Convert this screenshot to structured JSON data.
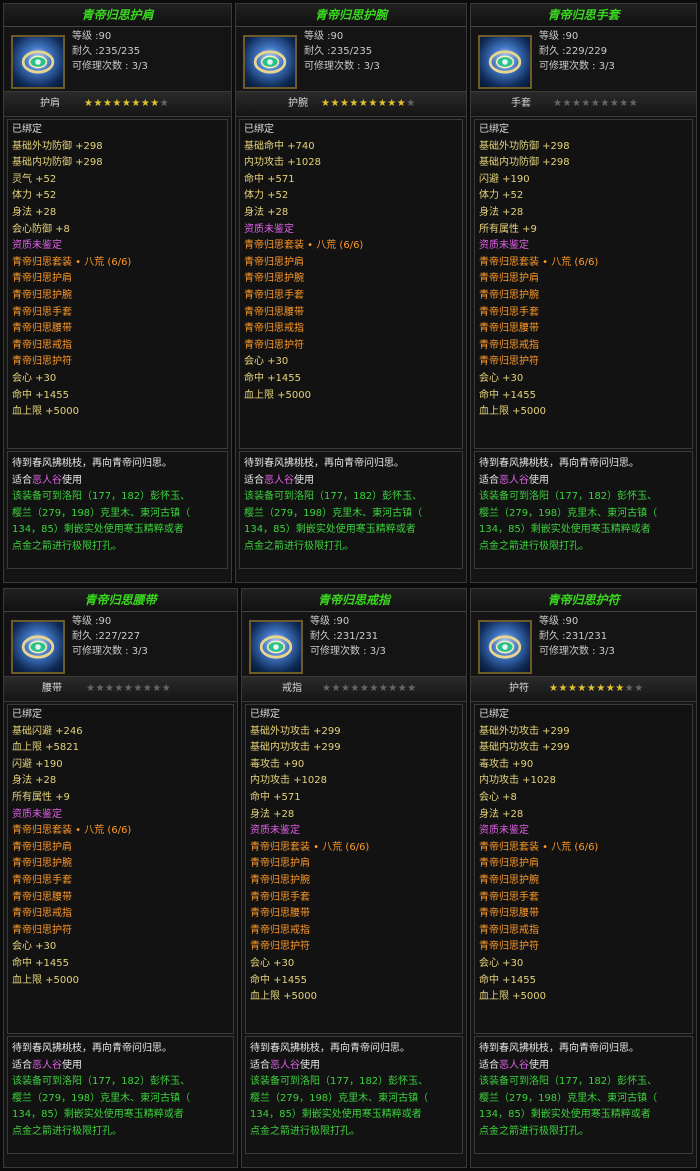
{
  "cards": [
    {
      "title": "青帝归思护肩",
      "icon": "shoulder-guard-icon",
      "level": "等级 :90",
      "durability": "耐久 :235/235",
      "repair": "可修理次数 : 3/3",
      "type": "护肩",
      "stars": 8,
      "stars_total": 9,
      "bound": "已绑定",
      "attrs": [
        "基础外功防御 +298",
        "基础内功防御 +298",
        "灵气 +52",
        "体力 +52",
        "身法 +28",
        "会心防御 +8"
      ],
      "quality": "资质未鉴定",
      "set_name": "青帝归思套装 • 八荒 (6/6)",
      "set_items": [
        "青帝归思护肩",
        "青帝归思护腕",
        "青帝归思手套",
        "青帝归思腰带",
        "青帝归思戒指",
        "青帝归思护符"
      ],
      "set_bonus": [
        "会心 +30",
        "命中 +1455",
        "血上限 +5000"
      ]
    },
    {
      "title": "青帝归思护腕",
      "icon": "bracer-icon",
      "level": "等级 :90",
      "durability": "耐久 :235/235",
      "repair": "可修理次数 : 3/3",
      "type": "护腕",
      "stars": 9,
      "stars_total": 10,
      "bound": "已绑定",
      "attrs": [
        "基础命中 +740",
        "内功攻击 +1028",
        "命中 +571",
        "体力 +52",
        "身法 +28"
      ],
      "quality": "资质未鉴定",
      "set_name": "青帝归思套装 • 八荒 (6/6)",
      "set_items": [
        "青帝归思护肩",
        "青帝归思护腕",
        "青帝归思手套",
        "青帝归思腰带",
        "青帝归思戒指",
        "青帝归思护符"
      ],
      "set_bonus": [
        "会心 +30",
        "命中 +1455",
        "血上限 +5000"
      ]
    },
    {
      "title": "青帝归思手套",
      "icon": "gloves-icon",
      "level": "等级 :90",
      "durability": "耐久 :229/229",
      "repair": "可修理次数 : 3/3",
      "type": "手套",
      "stars": 0,
      "stars_total": 9,
      "bound": "已绑定",
      "attrs": [
        "基础外功防御 +298",
        "基础内功防御 +298",
        "闪避 +190",
        "体力 +52",
        "身法 +28",
        "所有属性 +9"
      ],
      "quality": "资质未鉴定",
      "set_name": "青帝归思套装 • 八荒 (6/6)",
      "set_items": [
        "青帝归思护肩",
        "青帝归思护腕",
        "青帝归思手套",
        "青帝归思腰带",
        "青帝归思戒指",
        "青帝归思护符"
      ],
      "set_bonus": [
        "会心 +30",
        "命中 +1455",
        "血上限 +5000"
      ]
    },
    {
      "title": "青帝归思腰带",
      "icon": "belt-icon",
      "level": "等级 :90",
      "durability": "耐久 :227/227",
      "repair": "可修理次数 : 3/3",
      "type": "腰带",
      "stars": 0,
      "stars_total": 9,
      "bound": "已绑定",
      "attrs": [
        "基础闪避 +246",
        "血上限 +5821",
        "闪避 +190",
        "身法 +28",
        "所有属性 +9"
      ],
      "quality": "资质未鉴定",
      "set_name": "青帝归思套装 • 八荒 (6/6)",
      "set_items": [
        "青帝归思护肩",
        "青帝归思护腕",
        "青帝归思手套",
        "青帝归思腰带",
        "青帝归思戒指",
        "青帝归思护符"
      ],
      "set_bonus": [
        "会心 +30",
        "命中 +1455",
        "血上限 +5000"
      ]
    },
    {
      "title": "青帝归思戒指",
      "icon": "ring-icon",
      "level": "等级 :90",
      "durability": "耐久 :231/231",
      "repair": "可修理次数 : 3/3",
      "type": "戒指",
      "stars": 0,
      "stars_total": 10,
      "bound": "已绑定",
      "attrs": [
        "基础外功攻击 +299",
        "基础内功攻击 +299",
        "毒攻击 +90",
        "内功攻击 +1028",
        "命中 +571",
        "身法 +28"
      ],
      "quality": "资质未鉴定",
      "set_name": "青帝归思套装 • 八荒 (6/6)",
      "set_items": [
        "青帝归思护肩",
        "青帝归思护腕",
        "青帝归思手套",
        "青帝归思腰带",
        "青帝归思戒指",
        "青帝归思护符"
      ],
      "set_bonus": [
        "会心 +30",
        "命中 +1455",
        "血上限 +5000"
      ]
    },
    {
      "title": "青帝归思护符",
      "icon": "amulet-icon",
      "level": "等级 :90",
      "durability": "耐久 :231/231",
      "repair": "可修理次数 : 3/3",
      "type": "护符",
      "stars": 8,
      "stars_total": 10,
      "bound": "已绑定",
      "attrs": [
        "基础外功攻击 +299",
        "基础内功攻击 +299",
        "毒攻击 +90",
        "内功攻击 +1028",
        "会心 +8",
        "身法 +28"
      ],
      "quality": "资质未鉴定",
      "set_name": "青帝归思套装 • 八荒 (6/6)",
      "set_items": [
        "青帝归思护肩",
        "青帝归思护腕",
        "青帝归思手套",
        "青帝归思腰带",
        "青帝归思戒指",
        "青帝归思护符"
      ],
      "set_bonus": [
        "会心 +30",
        "命中 +1455",
        "血上限 +5000"
      ]
    }
  ],
  "description": {
    "line1": "待到春风拂桃枝，再向青帝问归思。",
    "suit_prefix": "适合",
    "suit_school": "恶人谷",
    "suit_suffix": "使用",
    "line3": "该装备可到洛阳（177，182）彭怀玉、",
    "line4": "樱兰（279，198）克里木、東河古镇（",
    "line5": "134，85）剩嵌实处使用寒玉精粹或者",
    "line6": "点金之箭进行极限打孔。"
  },
  "colors": {
    "title": "#39d81e",
    "stat": "#e5d27a",
    "quality": "#e060e8",
    "set": "#ff9a2a",
    "desc": "#3cd23c",
    "star_on": "#e3c230",
    "star_off": "#666666"
  }
}
